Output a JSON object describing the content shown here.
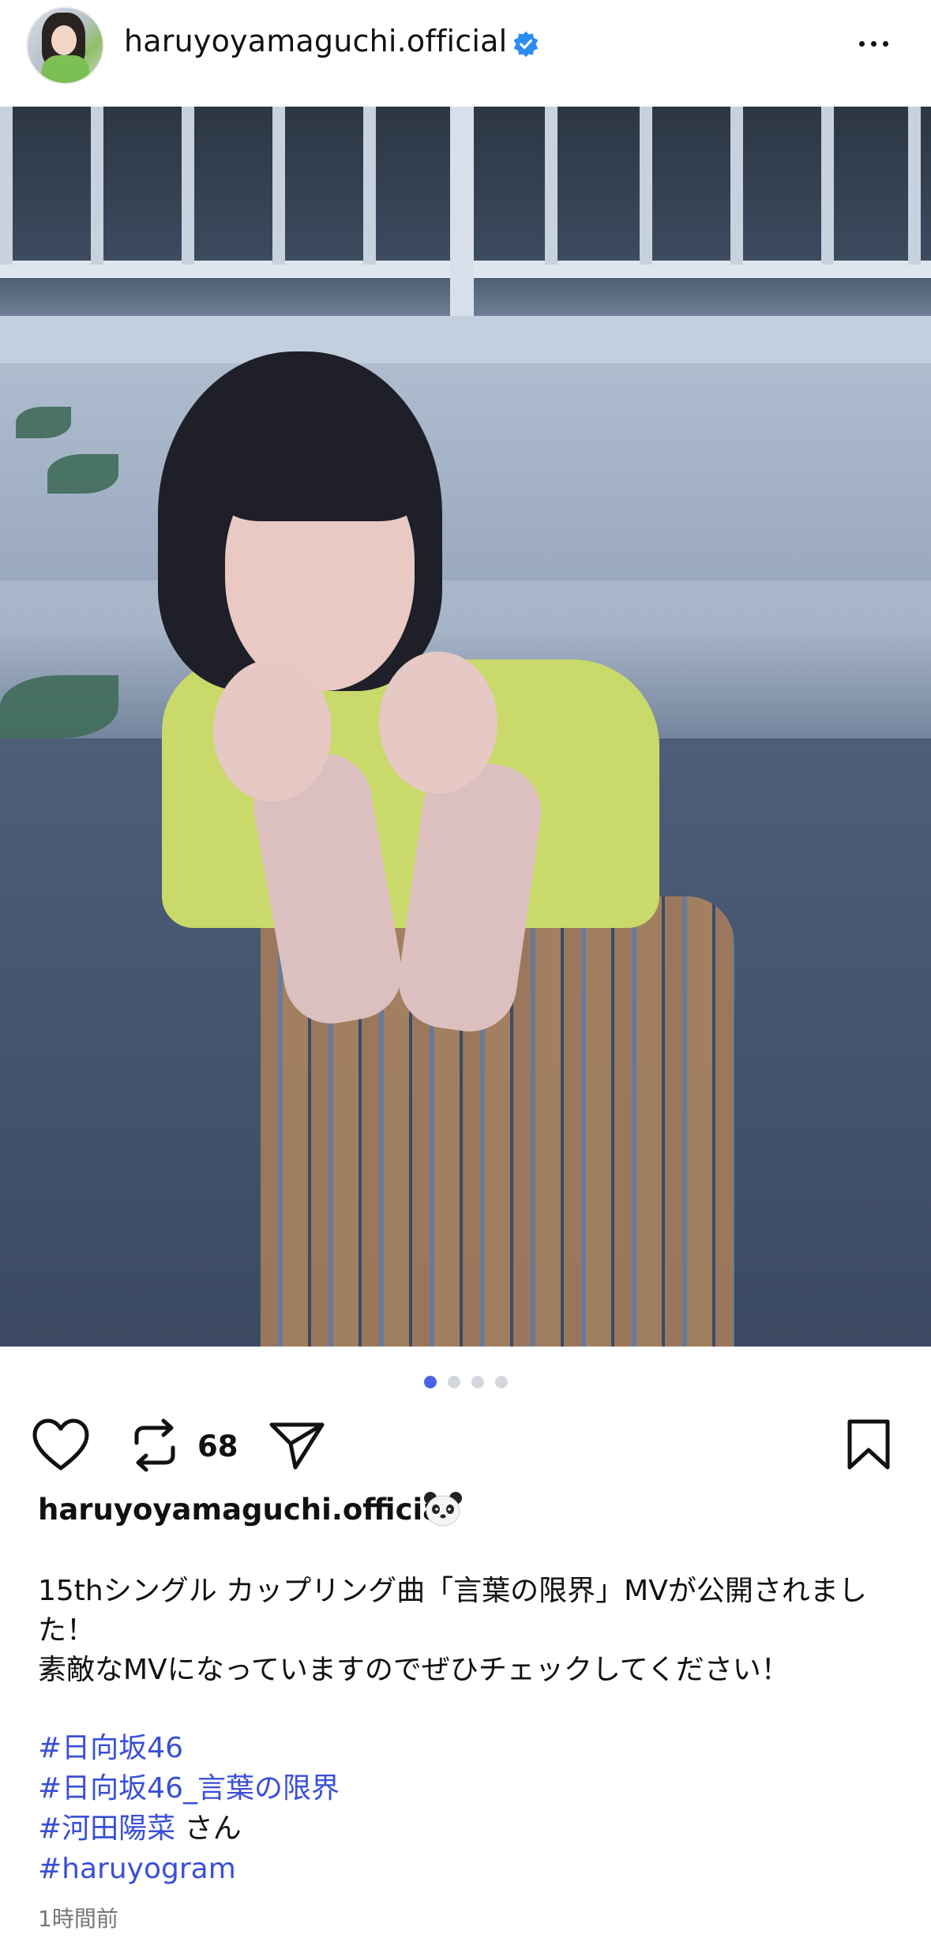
{
  "header": {
    "username": "haruyoyamaguchi.official",
    "verified": true,
    "avatar_icon": "profile-avatar",
    "more_icon": "more-horizontal-icon"
  },
  "post": {
    "carousel": {
      "total": 4,
      "active_index": 0
    },
    "tag_icon": "person-tag-icon"
  },
  "actions": {
    "like_icon": "heart-icon",
    "repost_icon": "repost-icon",
    "repost_count": "68",
    "share_icon": "send-icon",
    "save_icon": "bookmark-icon"
  },
  "caption": {
    "author": "haruyoyamaguchi.official",
    "emoji": "panda-icon",
    "line1": "15thシングル カップリング曲「言葉の限界」MVが公開されまし",
    "line2": "た！",
    "line3": "素敵なMVになっていますのでぜひチェックしてください！",
    "hashtags": [
      {
        "tag": "#日向坂46",
        "suffix": ""
      },
      {
        "tag": "#日向坂46_言葉の限界",
        "suffix": ""
      },
      {
        "tag": "#河田陽菜",
        "suffix": " さん"
      },
      {
        "tag": "#haruyogram",
        "suffix": ""
      }
    ],
    "timestamp": "1時間前"
  },
  "colors": {
    "link": "#3a4fd6",
    "active_dot": "#4a63e6",
    "verified": "#2d8cf0"
  }
}
